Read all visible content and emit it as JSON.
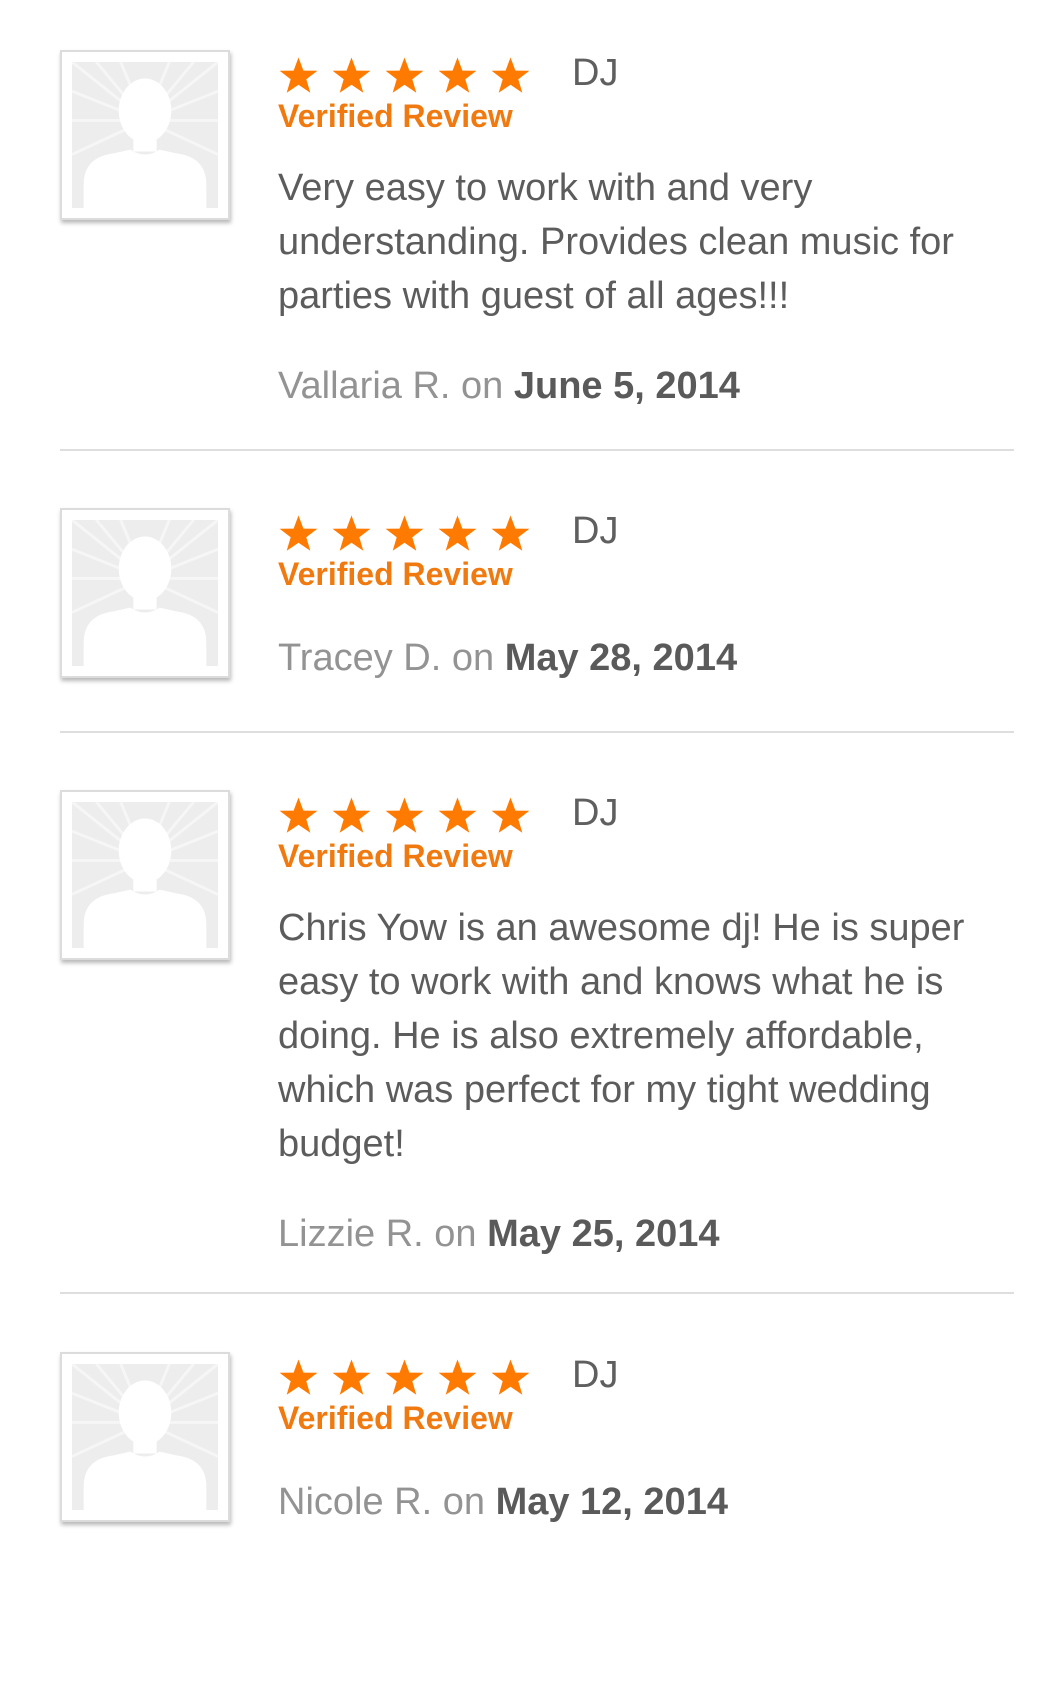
{
  "reviews": [
    {
      "rating": 5,
      "category": "DJ",
      "verified_label": "Verified Review",
      "text": "Very easy to work with and very understanding. Provides clean music for parties with guest of all ages!!!",
      "author": "Vallaria R.",
      "on": "on",
      "date": "June 5, 2014"
    },
    {
      "rating": 5,
      "category": "DJ",
      "verified_label": "Verified Review",
      "text": "",
      "author": "Tracey D.",
      "on": "on",
      "date": "May 28, 2014"
    },
    {
      "rating": 5,
      "category": "DJ",
      "verified_label": "Verified Review",
      "text": "Chris Yow is an awesome dj! He is super easy to work with and knows what he is doing. He is also extremely affordable, which was perfect for my tight wedding budget!",
      "author": "Lizzie R.",
      "on": "on",
      "date": "May 25, 2014"
    },
    {
      "rating": 5,
      "category": "DJ",
      "verified_label": "Verified Review",
      "text": "",
      "author": "Nicole R.",
      "on": "on",
      "date": "May 12, 2014"
    }
  ],
  "icons": {
    "avatar": "default-avatar-icon",
    "star": "star-icon"
  },
  "colors": {
    "star": "#ff7a00",
    "verified": "#f07a10",
    "text": "#5c5c5c",
    "author": "#939393",
    "divider": "#dedede"
  }
}
